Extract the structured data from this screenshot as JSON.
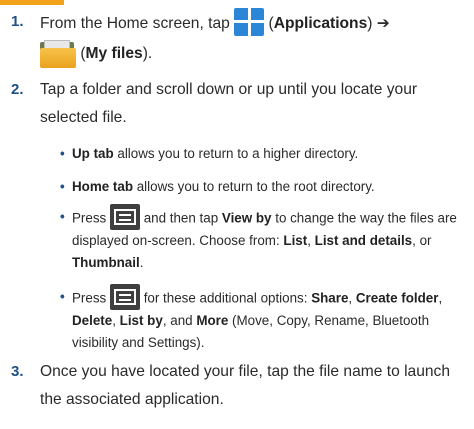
{
  "steps": [
    {
      "number": "1.",
      "line1_pre": "From the Home screen, tap",
      "line1_open": " (",
      "apps_label": "Applications",
      "line1_close": ") ➔",
      "line2_open": " (",
      "myfiles_label": "My files",
      "line2_close": ").",
      "icons": [
        "applications-icon",
        "my-files-folder-icon"
      ]
    },
    {
      "number": "2.",
      "text_line1": "Tap a folder and scroll down or up until you locate your",
      "text_line2": "selected file."
    },
    {
      "number": "3.",
      "text_line1": "Once you have located your file, tap the file name to launch",
      "text_line2": "the associated application."
    }
  ],
  "bullets": [
    {
      "dot": "•",
      "bold": "Up tab",
      "rest": " allows you to return to a higher directory."
    },
    {
      "dot": "•",
      "bold": "Home tab",
      "rest": " allows you to return to the root directory."
    },
    {
      "dot": "•",
      "press": "Press",
      "mid": " and then tap ",
      "bold_view": "View by",
      "rest_line1": " to change the way the files are",
      "line2": "displayed on-screen. Choose from: ",
      "opt_list": "List",
      "comma1": ", ",
      "opt_list_details": "List and details",
      "or": ", or",
      "opt_thumb": "Thumbnail",
      "period": ".",
      "icon": "menu-key-icon"
    },
    {
      "dot": "•",
      "press": "Press",
      "mid": " for these additional options: ",
      "share": "Share",
      "comma1": ", ",
      "create": "Create folder",
      "comma2": ",",
      "delete": "Delete",
      "comma3": ", ",
      "listby": "List by",
      "and": ", and ",
      "more": "More",
      "paren": " (Move, Copy, Rename, Bluetooth",
      "line3": "visibility and Settings).",
      "icon": "menu-key-icon"
    }
  ]
}
